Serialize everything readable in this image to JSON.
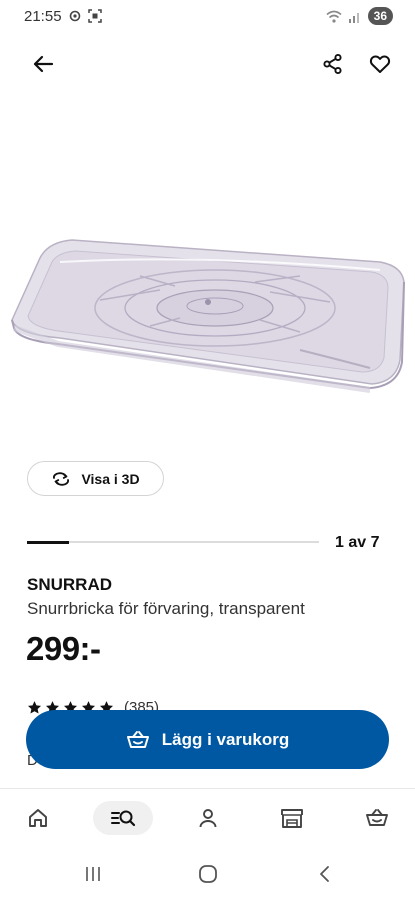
{
  "status_bar": {
    "time": "21:55",
    "battery": "36",
    "icons": [
      "settings-icon",
      "screenshot-icon",
      "wifi-icon",
      "signal-icon"
    ]
  },
  "top_bar": {
    "icons": [
      "back-arrow-icon",
      "share-icon",
      "heart-icon"
    ]
  },
  "product_image": {
    "icon": "product-tray-image"
  },
  "view_3d": {
    "label": "Visa i 3D",
    "icon": "rotate-3d-icon"
  },
  "gallery": {
    "current": 1,
    "total": 7,
    "indicator_text": "1 av 7"
  },
  "product": {
    "name": "SNURRAD",
    "description": "Snurrbricka för förvaring, transparent",
    "price": "299:-",
    "rating_stars": 5,
    "rating_count": "(385)"
  },
  "cart": {
    "label": "Lägg i varukorg",
    "icon": "basket-icon"
  },
  "bottom_nav": {
    "items": [
      "home-icon",
      "search-icon",
      "profile-icon",
      "store-icon",
      "basket-icon"
    ],
    "active": "search-icon"
  },
  "system_nav": {
    "items": [
      "recent-apps-icon",
      "home-circle-icon",
      "back-chevron-icon"
    ]
  },
  "colors": {
    "primary": "#0058a3",
    "text": "#111111"
  }
}
